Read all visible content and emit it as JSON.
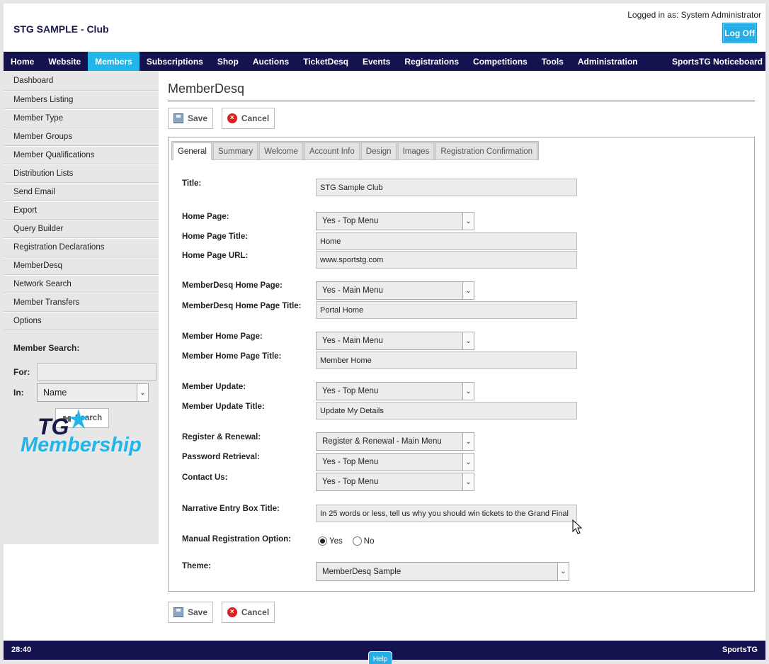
{
  "header": {
    "club_title": "STG SAMPLE - Club",
    "logged_in": "Logged in as: System Administrator",
    "logoff_label": "Log Off"
  },
  "nav": {
    "items": [
      "Home",
      "Website",
      "Members",
      "Subscriptions",
      "Shop",
      "Auctions",
      "TicketDesq",
      "Events",
      "Registrations",
      "Competitions",
      "Tools",
      "Administration"
    ],
    "active": "Members",
    "noticeboard": "SportsTG Noticeboard"
  },
  "sidebar": {
    "items": [
      "Dashboard",
      "Members Listing",
      "Member Type",
      "Member Groups",
      "Member Qualifications",
      "Distribution Lists",
      "Send Email",
      "Export",
      "Query Builder",
      "Registration Declarations",
      "MemberDesq",
      "Network Search",
      "Member Transfers",
      "Options"
    ],
    "search_title": "Member Search:",
    "for_label": "For:",
    "for_value": "",
    "in_label": "In:",
    "in_value": "Name",
    "search_button": "Search",
    "logo_text_1": "TG",
    "logo_text_2": "Membership"
  },
  "page": {
    "title": "MemberDesq",
    "save_label": "Save",
    "cancel_label": "Cancel"
  },
  "tabs": [
    "General",
    "Summary",
    "Welcome",
    "Account Info",
    "Design",
    "Images",
    "Registration Confirmation"
  ],
  "form": {
    "title_label": "Title:",
    "title_value": "STG Sample Club",
    "home_page_label": "Home Page:",
    "home_page_value": "Yes - Top Menu",
    "home_page_title_label": "Home Page Title:",
    "home_page_title_value": "Home",
    "home_page_url_label": "Home Page URL:",
    "home_page_url_value": "www.sportstg.com",
    "md_home_label": "MemberDesq Home Page:",
    "md_home_value": "Yes - Main Menu",
    "md_home_title_label": "MemberDesq Home Page Title:",
    "md_home_title_value": "Portal Home",
    "member_home_label": "Member Home Page:",
    "member_home_value": "Yes - Main Menu",
    "member_home_title_label": "Member Home Page Title:",
    "member_home_title_value": "Member Home",
    "member_update_label": "Member Update:",
    "member_update_value": "Yes - Top Menu",
    "member_update_title_label": "Member Update Title:",
    "member_update_title_value": "Update My Details",
    "register_label": "Register & Renewal:",
    "register_value": "Register & Renewal - Main Menu",
    "password_label": "Password Retrieval:",
    "password_value": "Yes - Top Menu",
    "contact_label": "Contact Us:",
    "contact_value": "Yes - Top Menu",
    "narrative_label": "Narrative Entry Box Title:",
    "narrative_value": "In 25 words or less, tell us why you should win tickets to the Grand Final",
    "manual_reg_label": "Manual Registration Option:",
    "manual_reg_yes": "Yes",
    "manual_reg_no": "No",
    "theme_label": "Theme:",
    "theme_value": "MemberDesq Sample"
  },
  "footer": {
    "time": "28:40",
    "brand": "SportsTG",
    "help": "Help"
  },
  "colors": {
    "nav_bg": "#14134f",
    "accent": "#22b6e8"
  }
}
